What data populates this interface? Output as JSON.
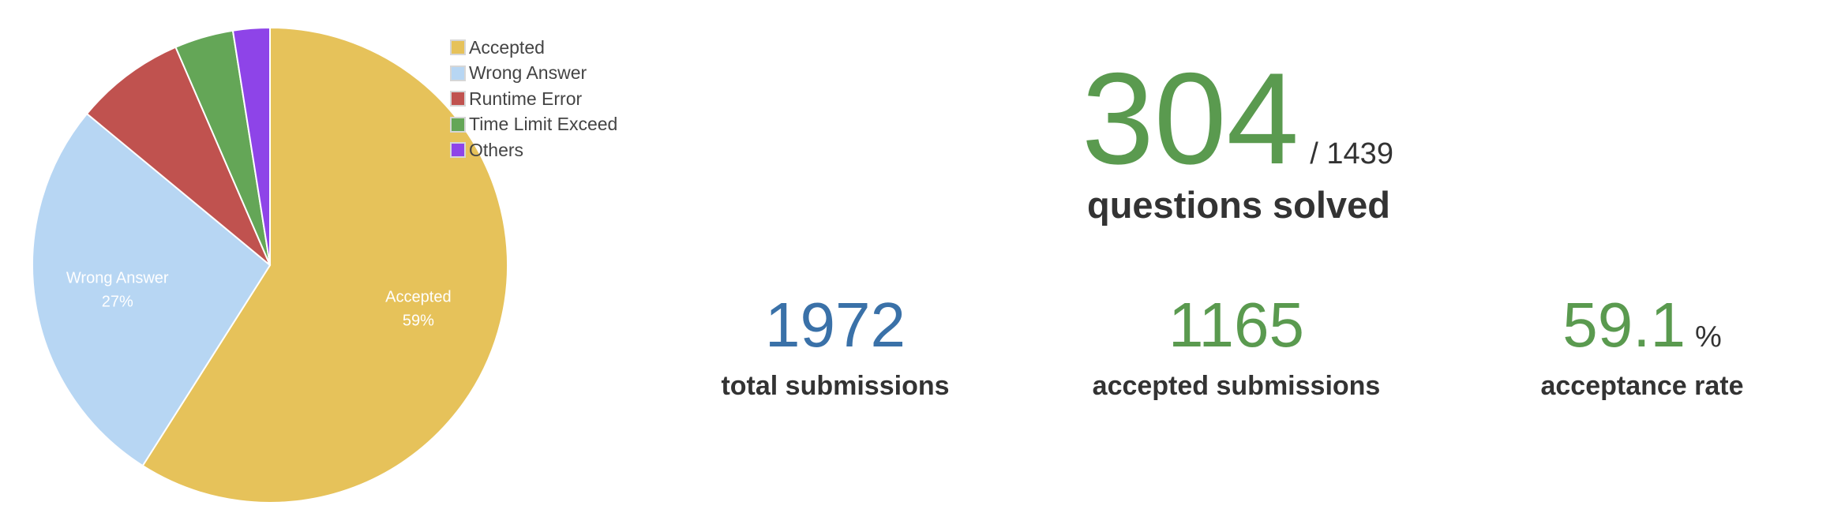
{
  "chart_data": {
    "type": "pie",
    "title": "",
    "slices": [
      {
        "label": "Accepted",
        "value": 59,
        "color": "#e6c25a",
        "data_label": "Accepted",
        "data_pct": "59%"
      },
      {
        "label": "Wrong Answer",
        "value": 27,
        "color": "#b7d6f3",
        "data_label": "Wrong Answer",
        "data_pct": "27%"
      },
      {
        "label": "Runtime Error",
        "value": 7.5,
        "color": "#c0524f",
        "data_label": "",
        "data_pct": ""
      },
      {
        "label": "Time Limit Exceed",
        "value": 4,
        "color": "#64a657",
        "data_label": "",
        "data_pct": ""
      },
      {
        "label": "Others",
        "value": 2.5,
        "color": "#8e44e8",
        "data_label": "",
        "data_pct": ""
      }
    ],
    "legend_position": "top-right"
  },
  "legend": {
    "items": [
      {
        "label": "Accepted",
        "color": "#e6c25a"
      },
      {
        "label": "Wrong Answer",
        "color": "#b7d6f3"
      },
      {
        "label": "Runtime Error",
        "color": "#c0524f"
      },
      {
        "label": "Time Limit Exceed",
        "color": "#64a657"
      },
      {
        "label": "Others",
        "color": "#8e44e8"
      }
    ]
  },
  "stats": {
    "solved": "304",
    "total_questions": "/ 1439",
    "solved_caption": "questions solved",
    "total_submissions": "1972",
    "total_submissions_caption": "total submissions",
    "accepted_submissions": "1165",
    "accepted_submissions_caption": "accepted submissions",
    "acceptance_rate": "59.1",
    "acceptance_rate_unit": "%",
    "acceptance_rate_caption": "acceptance rate"
  },
  "colors": {
    "green": "#5a9a4f",
    "blue": "#3a71a8"
  }
}
